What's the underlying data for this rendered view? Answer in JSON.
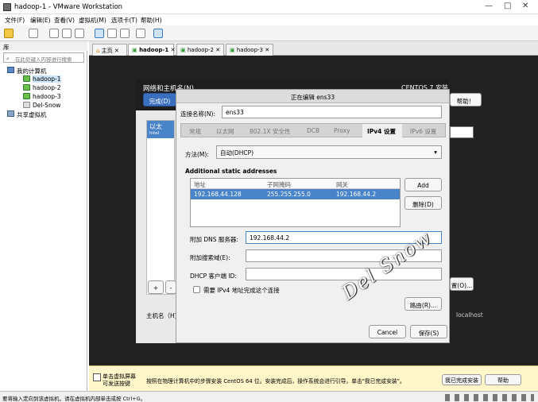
{
  "window": {
    "title": "hadoop-1 - VMware Workstation"
  },
  "menu": [
    "文件(F)",
    "编辑(E)",
    "查看(V)",
    "虚拟机(M)",
    "选项卡(T)",
    "帮助(H)"
  ],
  "library": {
    "title": "库",
    "search_placeholder": "在此处键入内容进行搜索",
    "root": "我的计算机",
    "vms": [
      "hadoop-1",
      "hadoop-2",
      "hadoop-3",
      "Del-Snow"
    ],
    "shared": "共享虚拟机"
  },
  "tabs": [
    "主页",
    "hadoop-1",
    "hadoop-2",
    "hadoop-3"
  ],
  "installer": {
    "title": "网络和主机名(N)",
    "done": "完成(D)",
    "product": "CENTOS 7 安装",
    "help": "帮助！",
    "iface_name": "以太",
    "iface_sub": "Intel",
    "add": "+",
    "remove": "-",
    "config": "置(O)...",
    "hostname_label": "主机名（H)",
    "hostname_value": "localhost"
  },
  "dialog": {
    "title": "正在编辑 ens33",
    "conn_name_label": "连接名称(N):",
    "conn_name_value": "ens33",
    "subtabs": [
      "常规",
      "以太网",
      "802.1X 安全性",
      "DCB",
      "Proxy",
      "IPv4 设置",
      "IPv6 设置"
    ],
    "method_label": "方法(M):",
    "method_value": "自动(DHCP)",
    "static_title": "Additional static addresses",
    "columns": [
      "地址",
      "子网掩码",
      "网关"
    ],
    "row": [
      "192.168.44.128",
      "255.255.255.0",
      "192.168.44.2"
    ],
    "add": "Add",
    "delete": "删除(D)",
    "dns_label": "附加 DNS 服务器:",
    "dns_value": "192.168.44.2",
    "search_label": "附加搜索域(E):",
    "dhcp_label": "DHCP 客户端 ID:",
    "require_label": "需要 IPv4 地址完成这个连接",
    "routes": "路由(R)...",
    "cancel": "Cancel",
    "save": "保存(S)"
  },
  "watermark": "Del Snow",
  "hint": {
    "line1": "单击虚拟屏幕",
    "line2": "可发送按键",
    "message": "按照在物理计算机中的步骤安装 CentOS 64 位。安装完成后，操作系统会进行引导，单击\"我已完成安装\"。",
    "done_btn": "我已完成安装",
    "help_btn": "帮助"
  },
  "status": "要将输入定向到该虚拟机，请在虚拟机内部单击或按 Ctrl+G。"
}
